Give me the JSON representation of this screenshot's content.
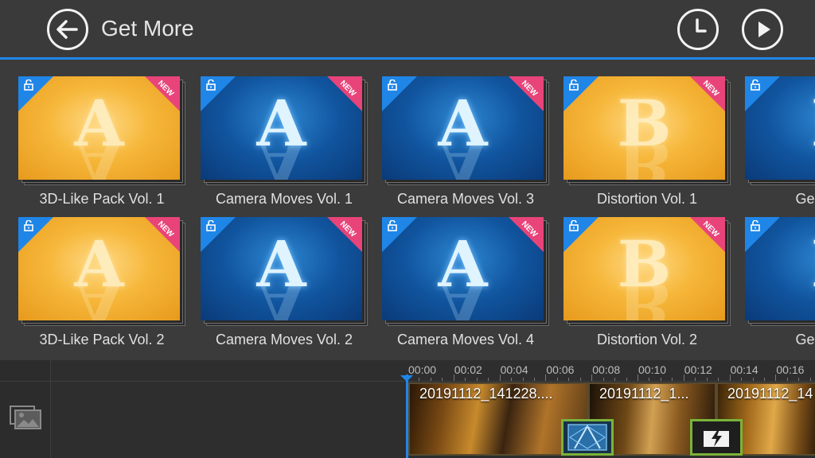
{
  "header": {
    "title": "Get More",
    "back_icon": "arrow-left-icon",
    "history_icon": "clock-icon",
    "play_icon": "play-icon",
    "accent_color": "#1f86e8"
  },
  "badges": {
    "new_label": "NEW",
    "new_color": "#e8447a",
    "lock_color": "#1f86e8"
  },
  "packs": [
    {
      "label": "3D-Like Pack Vol. 1",
      "letter": "A",
      "theme": "orange"
    },
    {
      "label": "Camera Moves Vol. 1",
      "letter": "A",
      "theme": "blue"
    },
    {
      "label": "Camera Moves Vol. 3",
      "letter": "A",
      "theme": "blue"
    },
    {
      "label": "Distortion Vol. 1",
      "letter": "B",
      "theme": "orange"
    },
    {
      "label": "Geometric",
      "letter": "I",
      "theme": "blue"
    },
    {
      "label": "3D-Like Pack Vol. 2",
      "letter": "A",
      "theme": "orange"
    },
    {
      "label": "Camera Moves Vol. 2",
      "letter": "A",
      "theme": "blue"
    },
    {
      "label": "Camera Moves Vol. 4",
      "letter": "A",
      "theme": "blue"
    },
    {
      "label": "Distortion Vol. 2",
      "letter": "B",
      "theme": "orange"
    },
    {
      "label": "Geometric",
      "letter": "I",
      "theme": "blue"
    }
  ],
  "timeline": {
    "ruler_labels": [
      "00:00",
      "00:02",
      "00:04",
      "00:06",
      "00:08",
      "00:10",
      "00:12",
      "00:14",
      "00:16"
    ],
    "media_icon": "image-stack-icon",
    "clips": [
      {
        "label": "20191112_141228...."
      },
      {
        "label": "20191112_1..."
      },
      {
        "label": "20191112_14"
      }
    ],
    "transitions": [
      {
        "icon": "transition-a-icon"
      },
      {
        "icon": "transition-flash-icon"
      }
    ]
  }
}
